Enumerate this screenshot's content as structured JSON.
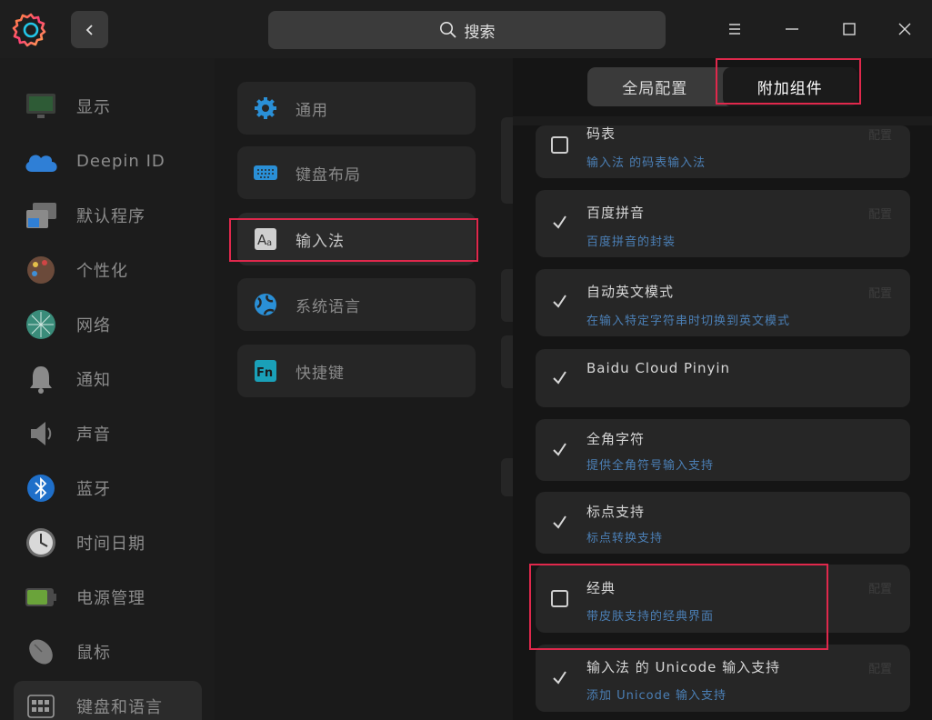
{
  "titlebar": {
    "search_placeholder": "搜索"
  },
  "sidebar": {
    "items": [
      {
        "label": "显示",
        "icon": "display-icon"
      },
      {
        "label": "Deepin ID",
        "icon": "cloud-icon"
      },
      {
        "label": "默认程序",
        "icon": "default-apps-icon"
      },
      {
        "label": "个性化",
        "icon": "personalization-icon"
      },
      {
        "label": "网络",
        "icon": "network-icon"
      },
      {
        "label": "通知",
        "icon": "bell-icon"
      },
      {
        "label": "声音",
        "icon": "speaker-icon"
      },
      {
        "label": "蓝牙",
        "icon": "bluetooth-icon"
      },
      {
        "label": "时间日期",
        "icon": "clock-icon"
      },
      {
        "label": "电源管理",
        "icon": "battery-icon"
      },
      {
        "label": "鼠标",
        "icon": "mouse-icon"
      },
      {
        "label": "键盘和语言",
        "icon": "keyboard-icon"
      }
    ]
  },
  "middle": {
    "items": [
      {
        "label": "通用",
        "icon": "gear-icon"
      },
      {
        "label": "键盘布局",
        "icon": "keyboard-layout-icon"
      },
      {
        "label": "输入法",
        "icon": "input-method-icon"
      },
      {
        "label": "系统语言",
        "icon": "globe-icon"
      },
      {
        "label": "快捷键",
        "icon": "fn-key-icon"
      }
    ]
  },
  "right": {
    "tabs": [
      {
        "label": "全局配置",
        "active": false
      },
      {
        "label": "附加组件",
        "active": true
      }
    ],
    "config_label": "配置",
    "plugins": [
      {
        "name": "码表",
        "desc": "输入法 的码表输入法",
        "checked": false,
        "has_config": true
      },
      {
        "name": "百度拼音",
        "desc": "百度拼音的封装",
        "checked": true,
        "has_config": true
      },
      {
        "name": "自动英文模式",
        "desc": "在输入特定字符串时切换到英文模式",
        "checked": true,
        "has_config": true
      },
      {
        "name": "Baidu Cloud Pinyin",
        "desc": "",
        "checked": true,
        "has_config": false
      },
      {
        "name": "全角字符",
        "desc": "提供全角符号输入支持",
        "checked": true,
        "has_config": false
      },
      {
        "name": "标点支持",
        "desc": "标点转换支持",
        "checked": true,
        "has_config": false
      },
      {
        "name": "经典",
        "desc": "带皮肤支持的经典界面",
        "checked": false,
        "has_config": true
      },
      {
        "name": "输入法 的 Unicode 输入支持",
        "desc": "添加 Unicode 输入支持",
        "checked": true,
        "has_config": true
      }
    ]
  },
  "colors": {
    "highlight": "#e0284c",
    "description_blue": "#4b7fb5",
    "background": "#161616"
  }
}
